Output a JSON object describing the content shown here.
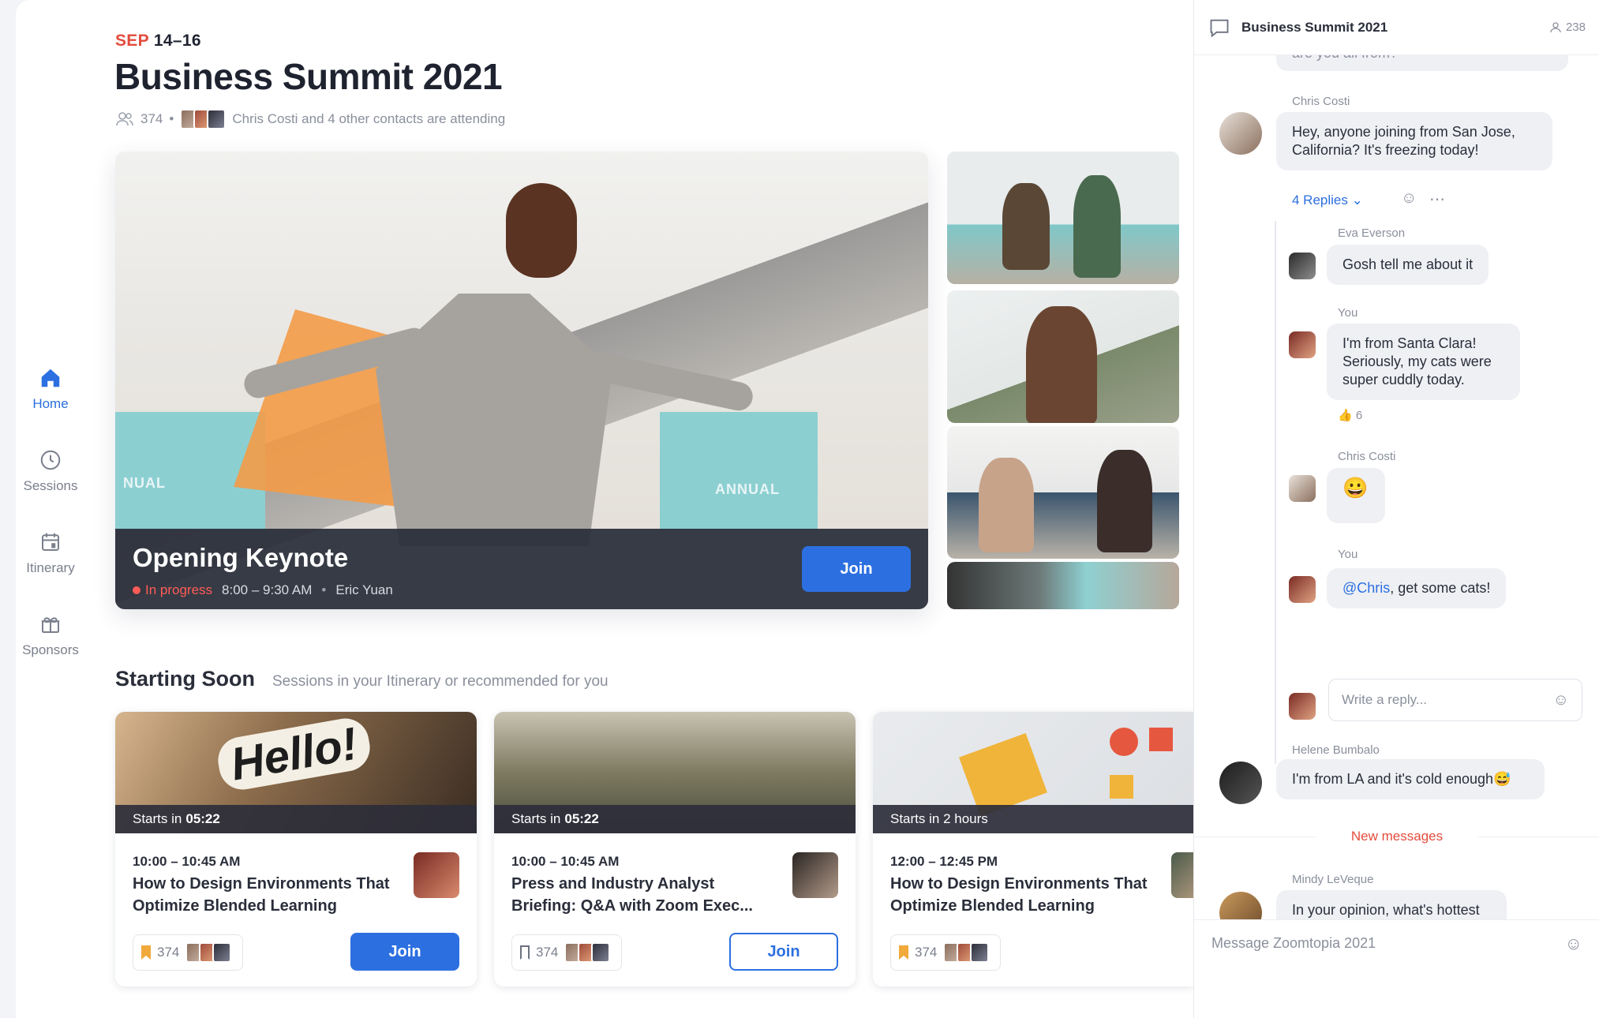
{
  "event": {
    "month": "SEP",
    "days": "14–16",
    "title": "Business Summit 2021",
    "attendee_count": "374",
    "attending_text": "Chris Costi and 4 other contacts are attending"
  },
  "sidebar": {
    "items": [
      {
        "label": "Home",
        "icon": "home-icon"
      },
      {
        "label": "Sessions",
        "icon": "clock-icon"
      },
      {
        "label": "Itinerary",
        "icon": "calendar-icon"
      },
      {
        "label": "Sponsors",
        "icon": "gift-icon"
      }
    ]
  },
  "hero": {
    "title": "Opening Keynote",
    "status": "In progress",
    "time": "8:00 – 9:30 AM",
    "speaker": "Eric Yuan",
    "join_label": "Join",
    "banner_text_left": "NUAL",
    "banner_text_right": "ANNUAL"
  },
  "starting_soon": {
    "title": "Starting Soon",
    "subtitle": "Sessions in your Itinerary or recommended for you",
    "cards": [
      {
        "starts_prefix": "Starts in",
        "starts_value": "05:22",
        "time": "10:00 – 10:45 AM",
        "name": "How to Design Environments That Optimize Blended Learning",
        "count": "374",
        "join_label": "Join",
        "image_text": "Hello!"
      },
      {
        "starts_prefix": "Starts in",
        "starts_value": "05:22",
        "time": "10:00 – 10:45 AM",
        "name": "Press and Industry Analyst Briefing: Q&A with Zoom Exec...",
        "count": "374",
        "join_label": "Join"
      },
      {
        "starts_prefix": "Starts in 2 hours",
        "starts_value": "",
        "time": "12:00 – 12:45 PM",
        "name": "How to Design Environments That Optimize Blended Learning",
        "count": "374"
      }
    ]
  },
  "chat": {
    "title": "Business Summit 2021",
    "participants": "238",
    "partial_top": "are you all from?",
    "messages": [
      {
        "author": "Chris Costi",
        "text": "Hey, anyone joining from San Jose, California? It's freezing today!"
      },
      {
        "replies": "4 Replies"
      },
      {
        "author": "Eva Everson",
        "text": "Gosh tell me about it"
      },
      {
        "author": "You",
        "text": "I'm from Santa Clara! Seriously, my cats were super cuddly today.",
        "reaction": "6"
      },
      {
        "author": "Chris Costi",
        "text": "😀"
      },
      {
        "author": "You",
        "mention": "@Chris",
        "text": ", get some cats!"
      },
      {
        "author": "Helene Bumbalo",
        "text": "I'm from LA and it's cold enough😅"
      },
      {
        "author": "Mindy LeVeque",
        "text": "In your opinion, what's hottest in the security field today?"
      }
    ],
    "reply_placeholder": "Write a reply...",
    "new_messages": "New messages",
    "compose_placeholder": "Message Zoomtopia 2021"
  },
  "colors": {
    "accent": "#2c6fe0",
    "live": "#ff5c57",
    "date_month": "#e24c3d",
    "bookmark": "#f0a93a"
  }
}
